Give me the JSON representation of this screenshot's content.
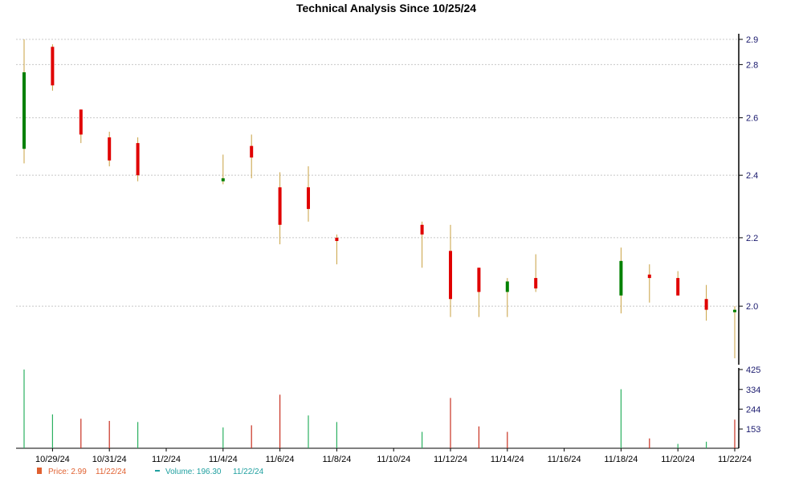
{
  "chart_data": {
    "type": "candlestick",
    "title": "Technical Analysis Since 10/25/24",
    "colors": {
      "up": "#008000",
      "down": "#e00000",
      "wick": "#c8a040",
      "volume_up": "#2bb060",
      "volume_down": "#c83020",
      "grid": "#c8c8c8",
      "axis": "#000000",
      "ytick": "#1a1a6e",
      "legend_price": "#e06030",
      "legend_volume": "#20a0a0"
    },
    "price_axis": {
      "ticks": [
        2.0,
        2.2,
        2.4,
        2.6,
        2.8,
        2.9
      ],
      "tick_labels": [
        "2.0",
        "2.2",
        "2.4",
        "2.6",
        "2.8",
        "2.9"
      ],
      "range": [
        1.86,
        2.9
      ],
      "scale": "log",
      "grid": true
    },
    "volume_axis": {
      "ticks": [
        153,
        244,
        334,
        425
      ],
      "tick_labels": [
        "153",
        "244",
        "334",
        "425"
      ],
      "range": [
        65,
        425
      ]
    },
    "x_axis": {
      "range": [
        "10/28/24",
        "11/22/24"
      ],
      "ticks": [
        "10/29/24",
        "10/31/24",
        "11/2/24",
        "11/4/24",
        "11/6/24",
        "11/8/24",
        "11/10/24",
        "11/12/24",
        "11/14/24",
        "11/16/24",
        "11/18/24",
        "11/20/24",
        "11/22/24"
      ]
    },
    "candles": [
      {
        "date": "10/28/24",
        "open": 2.49,
        "high": 2.9,
        "low": 2.44,
        "close": 2.77
      },
      {
        "date": "10/29/24",
        "open": 2.87,
        "high": 2.88,
        "low": 2.7,
        "close": 2.72
      },
      {
        "date": "10/30/24",
        "open": 2.63,
        "high": 2.63,
        "low": 2.51,
        "close": 2.54
      },
      {
        "date": "10/31/24",
        "open": 2.53,
        "high": 2.55,
        "low": 2.43,
        "close": 2.45
      },
      {
        "date": "11/1/24",
        "open": 2.51,
        "high": 2.53,
        "low": 2.38,
        "close": 2.4
      },
      {
        "date": "11/4/24",
        "open": 2.38,
        "high": 2.47,
        "low": 2.37,
        "close": 2.39
      },
      {
        "date": "11/5/24",
        "open": 2.5,
        "high": 2.54,
        "low": 2.39,
        "close": 2.46
      },
      {
        "date": "11/6/24",
        "open": 2.36,
        "high": 2.41,
        "low": 2.18,
        "close": 2.24
      },
      {
        "date": "11/7/24",
        "open": 2.36,
        "high": 2.43,
        "low": 2.25,
        "close": 2.29
      },
      {
        "date": "11/8/24",
        "open": 2.2,
        "high": 2.21,
        "low": 2.12,
        "close": 2.19
      },
      {
        "date": "11/11/24",
        "open": 2.24,
        "high": 2.25,
        "low": 2.11,
        "close": 2.21
      },
      {
        "date": "11/12/24",
        "open": 2.16,
        "high": 2.24,
        "low": 1.97,
        "close": 2.02
      },
      {
        "date": "11/13/24",
        "open": 2.11,
        "high": 2.11,
        "low": 1.97,
        "close": 2.04
      },
      {
        "date": "11/14/24",
        "open": 2.04,
        "high": 2.08,
        "low": 1.97,
        "close": 2.07
      },
      {
        "date": "11/15/24",
        "open": 2.08,
        "high": 2.15,
        "low": 2.04,
        "close": 2.05
      },
      {
        "date": "11/18/24",
        "open": 2.03,
        "high": 2.17,
        "low": 1.98,
        "close": 2.13
      },
      {
        "date": "11/19/24",
        "open": 2.09,
        "high": 2.12,
        "low": 2.01,
        "close": 2.08
      },
      {
        "date": "11/20/24",
        "open": 2.08,
        "high": 2.1,
        "low": 2.03,
        "close": 2.03
      },
      {
        "date": "11/21/24",
        "open": 2.02,
        "high": 2.06,
        "low": 1.96,
        "close": 1.99
      },
      {
        "date": "11/22/24",
        "open": 1.99,
        "high": 2.0,
        "low": 1.86,
        "close": 1.99
      }
    ],
    "volume": [
      {
        "date": "10/28/24",
        "value": 425,
        "direction": "up"
      },
      {
        "date": "10/29/24",
        "value": 220,
        "direction": "up"
      },
      {
        "date": "10/30/24",
        "value": 200,
        "direction": "down"
      },
      {
        "date": "10/31/24",
        "value": 190,
        "direction": "down"
      },
      {
        "date": "11/1/24",
        "value": 185,
        "direction": "up"
      },
      {
        "date": "11/4/24",
        "value": 160,
        "direction": "up"
      },
      {
        "date": "11/5/24",
        "value": 170,
        "direction": "down"
      },
      {
        "date": "11/6/24",
        "value": 310,
        "direction": "down"
      },
      {
        "date": "11/7/24",
        "value": 215,
        "direction": "up"
      },
      {
        "date": "11/8/24",
        "value": 185,
        "direction": "up"
      },
      {
        "date": "11/11/24",
        "value": 140,
        "direction": "up"
      },
      {
        "date": "11/12/24",
        "value": 295,
        "direction": "down"
      },
      {
        "date": "11/13/24",
        "value": 165,
        "direction": "down"
      },
      {
        "date": "11/14/24",
        "value": 140,
        "direction": "down"
      },
      {
        "date": "11/18/24",
        "value": 335,
        "direction": "up"
      },
      {
        "date": "11/19/24",
        "value": 110,
        "direction": "down"
      },
      {
        "date": "11/20/24",
        "value": 85,
        "direction": "up"
      },
      {
        "date": "11/21/24",
        "value": 95,
        "direction": "up"
      },
      {
        "date": "11/22/24",
        "value": 196,
        "direction": "down"
      }
    ],
    "legend": {
      "position": "bottom-left",
      "price_label": "Price: 2.99",
      "price_date": "11/22/24",
      "volume_label": "Volume: 196.30",
      "volume_date": "11/22/24"
    }
  }
}
